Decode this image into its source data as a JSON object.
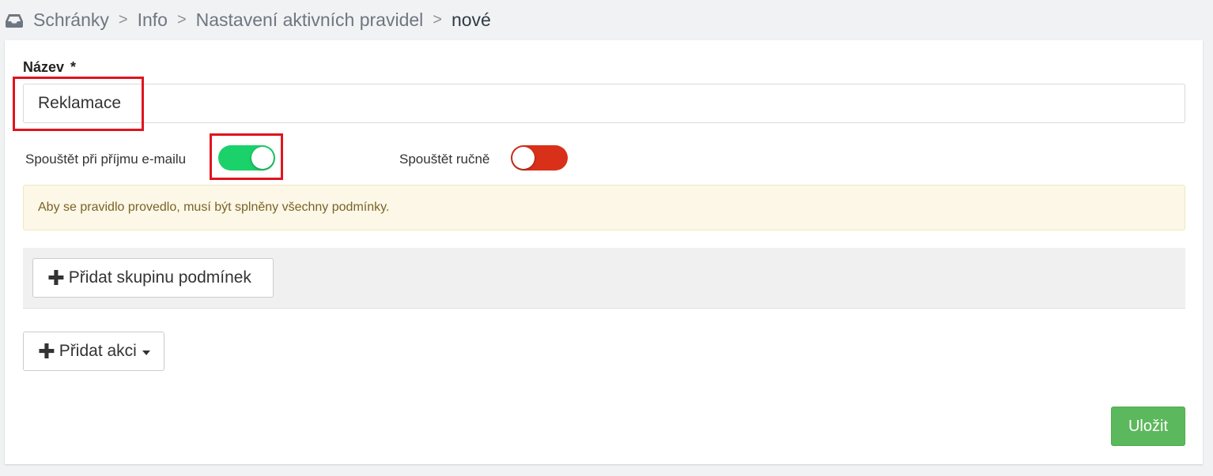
{
  "breadcrumb": {
    "icon": "inbox-icon",
    "items": [
      "Schránky",
      "Info",
      "Nastavení aktivních pravidel"
    ],
    "separator": ">",
    "current": "nové"
  },
  "form": {
    "name_label": "Název",
    "required_mark": "*",
    "name_value": "Reklamace",
    "trigger_on_receive_label": "Spouštět při příjmu e-mailu",
    "trigger_on_receive_on": true,
    "trigger_manual_label": "Spouštět ručně",
    "trigger_manual_on": false,
    "alert_text": "Aby se pravidlo provedlo, musí být splněny všechny podmínky.",
    "add_condition_group_label": "Přidat skupinu podmínek",
    "add_action_label": "Přidat akci",
    "save_label": "Uložit"
  },
  "colors": {
    "toggle_on": "#1bd16a",
    "toggle_off": "#d9301a",
    "save": "#5cb85c",
    "highlight": "#e0141e"
  }
}
